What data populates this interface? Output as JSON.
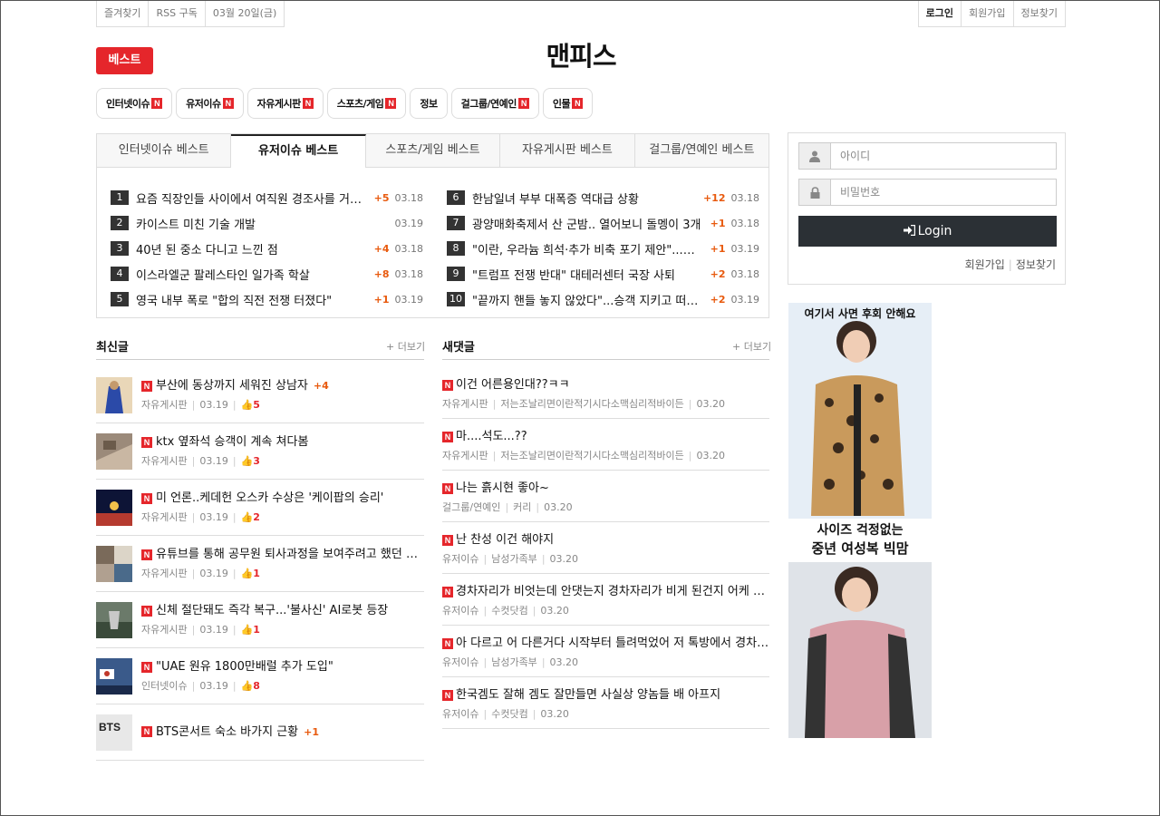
{
  "topbar": {
    "favorite": "즐겨찾기",
    "rss": "RSS 구독",
    "date": "03월 20일(금)",
    "login": "로그인",
    "signup": "회원가입",
    "find": "정보찾기"
  },
  "header": {
    "best_label": "베스트",
    "logo": "맨피스"
  },
  "categories": [
    "인터넷이슈",
    "유저이슈",
    "자유게시판",
    "스포츠/게임",
    "정보",
    "걸그룹/연예인",
    "인물"
  ],
  "new_badge": "N",
  "best": {
    "tabs": [
      "인터넷이슈 베스트",
      "유저이슈 베스트",
      "스포츠/게임 베스트",
      "자유게시판 베스트",
      "걸그룹/연예인 베스트"
    ],
    "items": [
      {
        "rank": "1",
        "title": "요즘 직장인들 사이에서 여직원 경조사를 거르는 이유",
        "plus": "+5",
        "date": "03.18"
      },
      {
        "rank": "2",
        "title": "카이스트 미친 기술 개발",
        "plus": "",
        "date": "03.19"
      },
      {
        "rank": "3",
        "title": "40년 된 중소 다니고 느낀 점",
        "plus": "+4",
        "date": "03.18"
      },
      {
        "rank": "4",
        "title": "이스라엘군 팔레스타인 일가족 학살",
        "plus": "+8",
        "date": "03.18"
      },
      {
        "rank": "5",
        "title": "영국 내부 폭로 \"합의 직전 전쟁 터졌다\"",
        "plus": "+1",
        "date": "03.19"
      },
      {
        "rank": "6",
        "title": "한남일녀 부부 대폭증 역대급 상황",
        "plus": "+12",
        "date": "03.18"
      },
      {
        "rank": "7",
        "title": "광양매화축제서 산 군밤.. 열어보니 돌멩이 3개",
        "plus": "+1",
        "date": "03.18"
      },
      {
        "rank": "8",
        "title": "\"이란, 우라늄 희석·추가 비축 포기 제안\"...그런데 결렬",
        "plus": "+1",
        "date": "03.19"
      },
      {
        "rank": "9",
        "title": "\"트럼프 전쟁 반대\" 대테러센터 국장 사퇴",
        "plus": "+2",
        "date": "03.18"
      },
      {
        "rank": "10",
        "title": "\"끝까지 핸들 놓지 않았다\"...승객 지키고 떠난 버스기사",
        "plus": "+2",
        "date": "03.19"
      }
    ]
  },
  "latest": {
    "title": "최신글",
    "more": "+ 더보기",
    "items": [
      {
        "title": "부산에 동상까지 세워진 상남자",
        "plus": "+4",
        "board": "자유게시판",
        "date": "03.19",
        "likes": "5"
      },
      {
        "title": "ktx 옆좌석 승객이 계속 쳐다봄",
        "plus": "",
        "board": "자유게시판",
        "date": "03.19",
        "likes": "3"
      },
      {
        "title": "미 언론..케데헌 오스카 수상은 '케이팝의 승리'",
        "plus": "",
        "board": "자유게시판",
        "date": "03.19",
        "likes": "2"
      },
      {
        "title": "유튜브를 통해 공무원 퇴사과정을 보여주려고 했던 공무원",
        "plus": "",
        "board": "자유게시판",
        "date": "03.19",
        "likes": "1"
      },
      {
        "title": "신체 절단돼도 즉각 복구...'불사신' AI로봇 등장",
        "plus": "",
        "board": "자유게시판",
        "date": "03.19",
        "likes": "1"
      },
      {
        "title": "\"UAE 원유 1800만배럴 추가 도입\"",
        "plus": "",
        "board": "인터넷이슈",
        "date": "03.19",
        "likes": "8"
      },
      {
        "title": "BTS콘서트 숙소 바가지 근황",
        "plus": "+1",
        "board": "",
        "date": "",
        "likes": ""
      }
    ]
  },
  "comments": {
    "title": "새댓글",
    "more": "+ 더보기",
    "items": [
      {
        "title": "이건 어른용인대??ㅋㅋ",
        "board": "자유게시판",
        "author": "저는조날리면이란적기시다소맥심리적바이든",
        "date": "03.20"
      },
      {
        "title": "마....석도...??",
        "board": "자유게시판",
        "author": "저는조날리면이란적기시다소맥심리적바이든",
        "date": "03.20"
      },
      {
        "title": "나는 흙시현 좋아~",
        "board": "걸그룹/연예인",
        "author": "커리",
        "date": "03.20"
      },
      {
        "title": "난 찬성 이건 해야지",
        "board": "유저이슈",
        "author": "남성가족부",
        "date": "03.20"
      },
      {
        "title": "경차자리가 비엇는데 안댓는지 경차자리가 비게 된건지 어케 아냐고",
        "board": "유저이슈",
        "author": "수컷닷컴",
        "date": "03.20"
      },
      {
        "title": "아 다르고 어 다른거다 시작부터 틀려먹었어 저 톡방에서 경차 얘기",
        "board": "유저이슈",
        "author": "남성가족부",
        "date": "03.20"
      },
      {
        "title": "한국겜도 잘해 겜도 잘만들면 사실상 양놈들 배 아프지",
        "board": "유저이슈",
        "author": "수컷닷컴",
        "date": "03.20"
      }
    ]
  },
  "login": {
    "id_placeholder": "아이디",
    "pw_placeholder": "비밀번호",
    "button": "Login",
    "signup": "회원가입",
    "find": "정보찾기"
  },
  "ad": {
    "text1": "여기서 사면 후회 안해요",
    "text2": "사이즈 걱정없는",
    "text3": "중년 여성복 빅맘"
  },
  "colors": {
    "accent": "#e5262b",
    "plus": "#e85a0e",
    "login_button": "#2b3035"
  }
}
